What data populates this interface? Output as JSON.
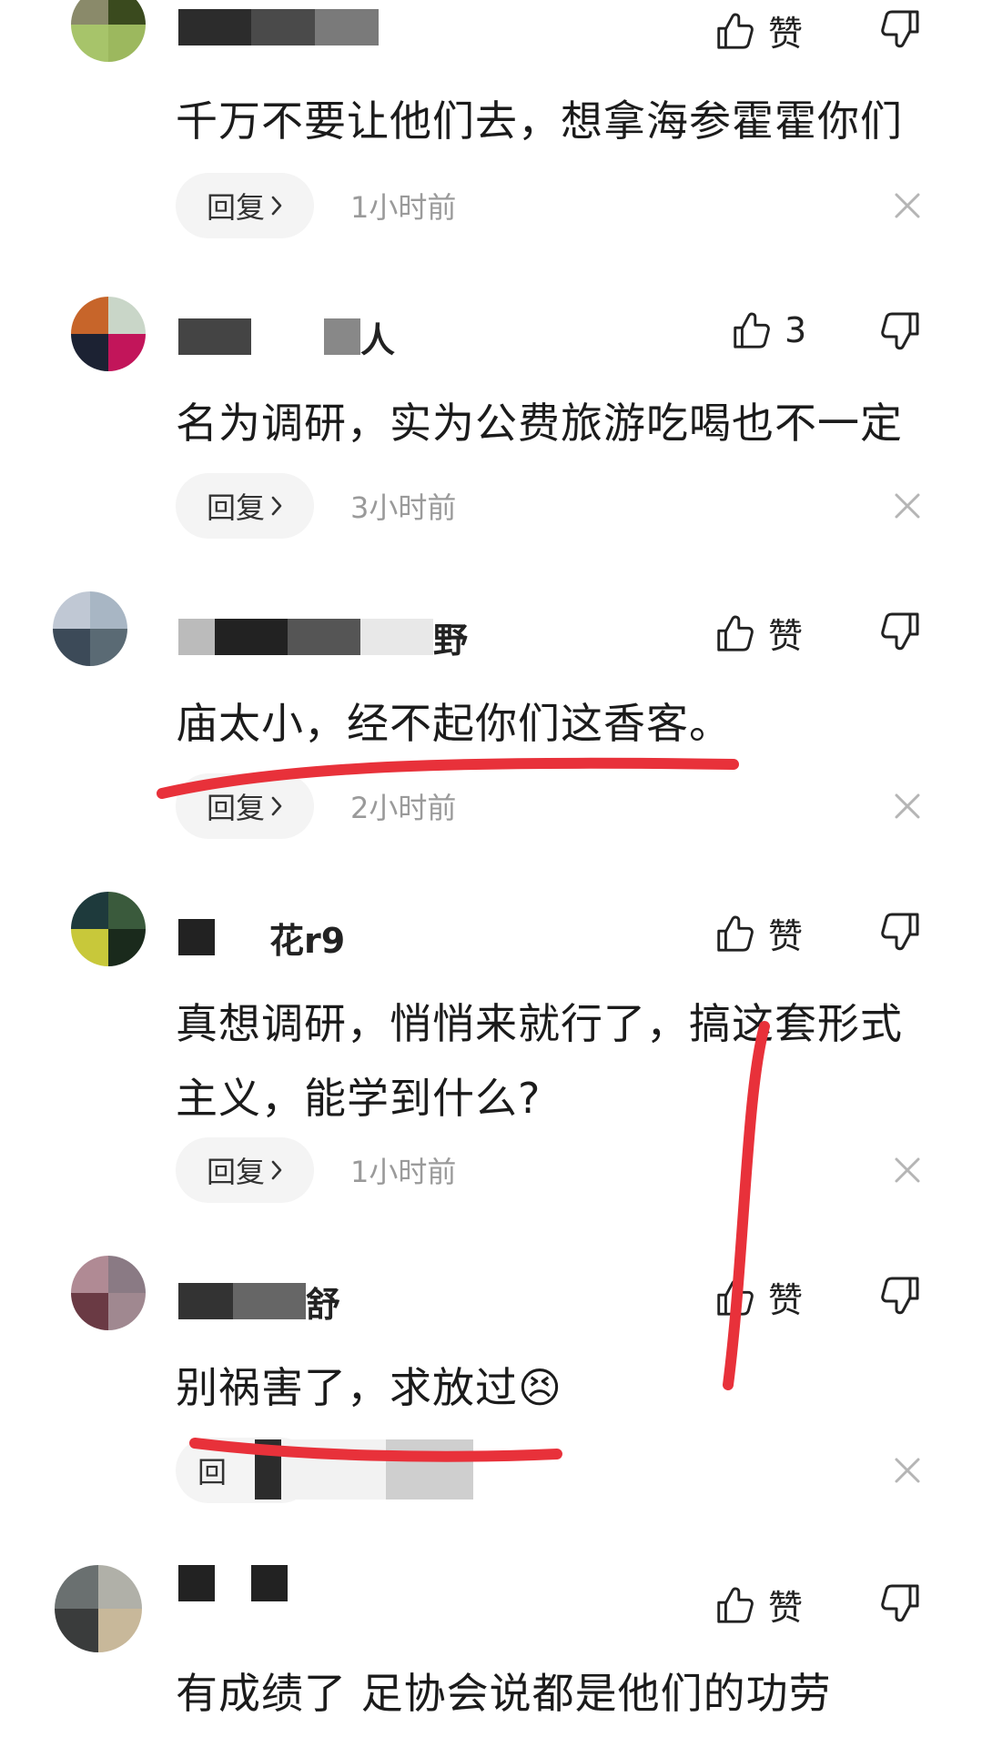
{
  "comments": [
    {
      "username": "",
      "text": "千万不要让他们去，想拿海参霍霍你们",
      "like": "赞",
      "reply": "回复",
      "time": "1小时前"
    },
    {
      "username": "人",
      "text": "名为调研，实为公费旅游吃喝也不一定",
      "like": "3",
      "reply": "回复",
      "time": "3小时前"
    },
    {
      "username": "野",
      "text": "庙太小，经不起你们这香客。",
      "like": "赞",
      "reply": "回复",
      "time": "2小时前"
    },
    {
      "username": "花r9",
      "text": "真想调研，悄悄来就行了，搞这套形式主义，能学到什么?",
      "like": "赞",
      "reply": "回复",
      "time": "1小时前"
    },
    {
      "username": "舒",
      "text": "别祸害了，求放过",
      "emoji": "😣",
      "like": "赞",
      "reply": "回",
      "time": ""
    },
    {
      "username": "",
      "text": "有成绩了 足协会说都是他们的功劳",
      "like": "赞"
    }
  ],
  "colors": {
    "annotation_red": "#e8313a",
    "muted_text": "#9a9a9a",
    "reply_bg": "#f4f4f4"
  },
  "icons": [
    "thumbs-up-icon",
    "thumbs-down-icon",
    "close-icon",
    "chevron-right-icon"
  ]
}
